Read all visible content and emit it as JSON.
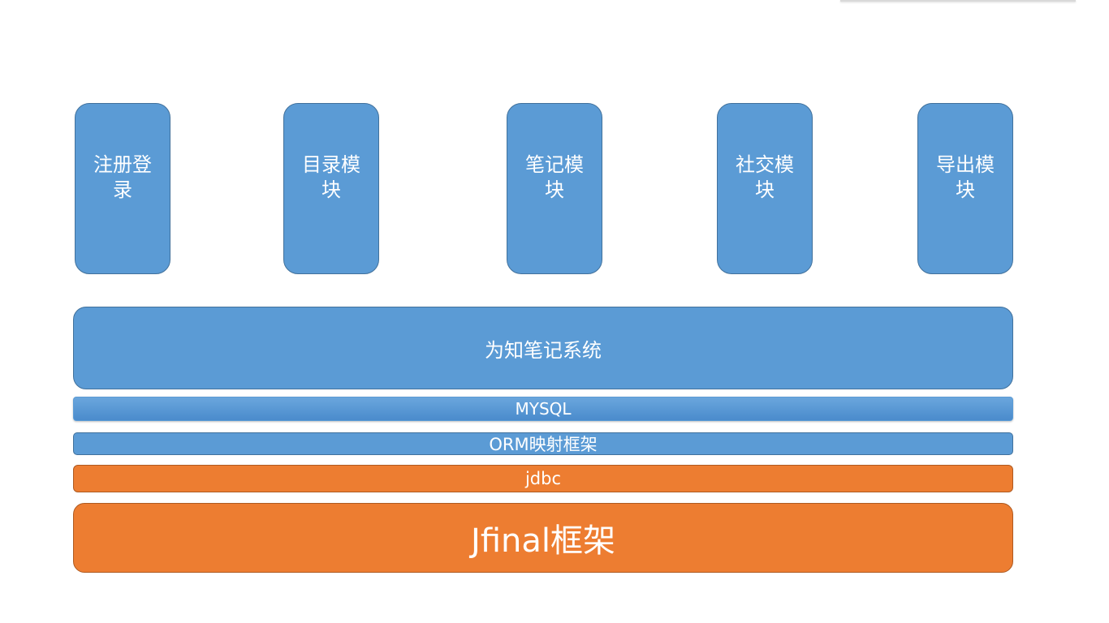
{
  "modules": [
    {
      "label": "注册登录"
    },
    {
      "label": "目录模块"
    },
    {
      "label": "笔记模块"
    },
    {
      "label": "社交模块"
    },
    {
      "label": "导出模块"
    }
  ],
  "layers": {
    "system": "为知笔记系统",
    "mysql": "MYSQL",
    "orm": "ORM映射框架",
    "jdbc": "jdbc",
    "jfinal": "Jfinal框架"
  },
  "colors": {
    "blue_fill": "#5b9bd5",
    "blue_border": "#41719c",
    "orange_fill": "#ed7d31",
    "orange_border": "#ae5a21",
    "text": "#ffffff"
  }
}
